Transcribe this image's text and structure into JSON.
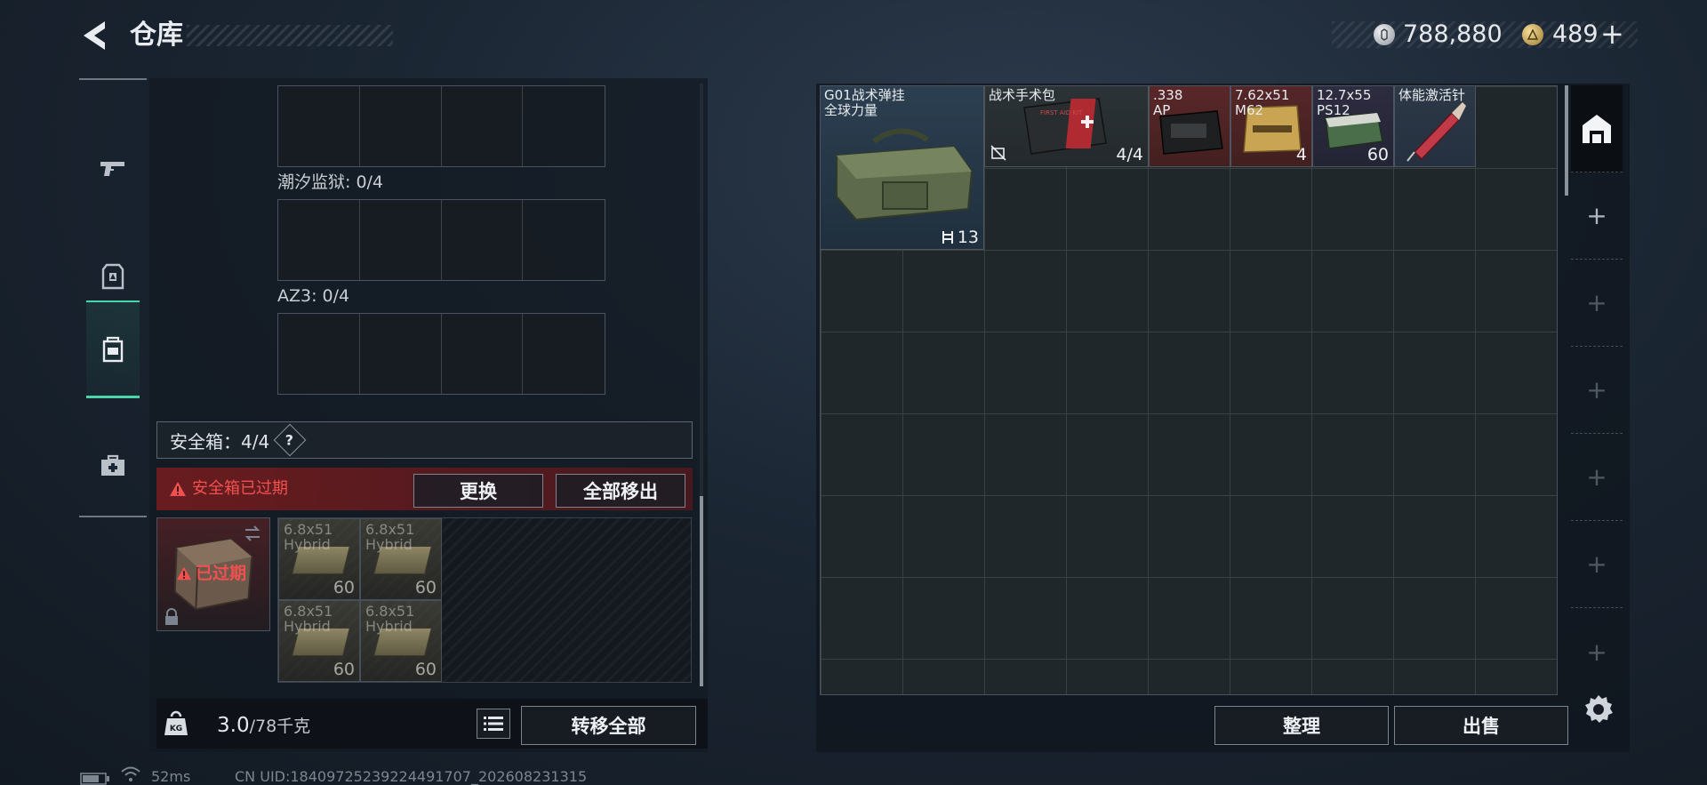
{
  "header": {
    "title": "仓库",
    "silver_amount": "788,880",
    "gold_amount": "489",
    "gold_plus": "+"
  },
  "sidebar": {
    "tabs": [
      {
        "icon": "pistol-icon",
        "active": false
      },
      {
        "icon": "armor-vest-icon",
        "active": false
      },
      {
        "icon": "backpack-icon",
        "active": true
      },
      {
        "icon": "medkit-case-icon",
        "active": false
      }
    ]
  },
  "loadout": {
    "rig_slots": [
      {
        "label": "潮汐监狱: 0/4"
      },
      {
        "label": "AZ3: 0/4"
      }
    ]
  },
  "safebox": {
    "header": "安全箱：4/4",
    "help": "?",
    "expired_warning": "安全箱已过期",
    "replace_label": "更换",
    "remove_all_label": "全部移出",
    "icon_expired_label": "已过期",
    "items": [
      {
        "name": "6.8x51\nHybrid",
        "count": "60"
      },
      {
        "name": "6.8x51\nHybrid",
        "count": "60"
      },
      {
        "name": "6.8x51\nHybrid",
        "count": "60"
      },
      {
        "name": "6.8x51\nHybrid",
        "count": "60"
      }
    ]
  },
  "footer_left": {
    "weight_value": "3.0",
    "weight_max": "/78千克",
    "weight_icon_text": "KG",
    "transfer_all_label": "转移全部"
  },
  "warehouse": {
    "items": [
      {
        "name": "G01战术弹挂\n全球力量",
        "count": "13"
      },
      {
        "name": "战术手术包",
        "count": "4/4",
        "inner_text": "FIRST AID KIT"
      },
      {
        "name": ".338\nAP",
        "count": ""
      },
      {
        "name": "7.62x51\nM62",
        "count": "4"
      },
      {
        "name": "12.7x55\nPS12",
        "count": "60"
      },
      {
        "name": "体能激活针",
        "count": ""
      }
    ],
    "sort_label": "整理",
    "sell_label": "出售",
    "rail_plus": "+"
  },
  "status": {
    "ping": "52ms",
    "uid": "CN UID:1840972523922449170​7_202608231315"
  },
  "colors": {
    "accent_green": "#49d6a8",
    "warning_red": "#f0514f",
    "expired_bg": "#781c1e"
  }
}
